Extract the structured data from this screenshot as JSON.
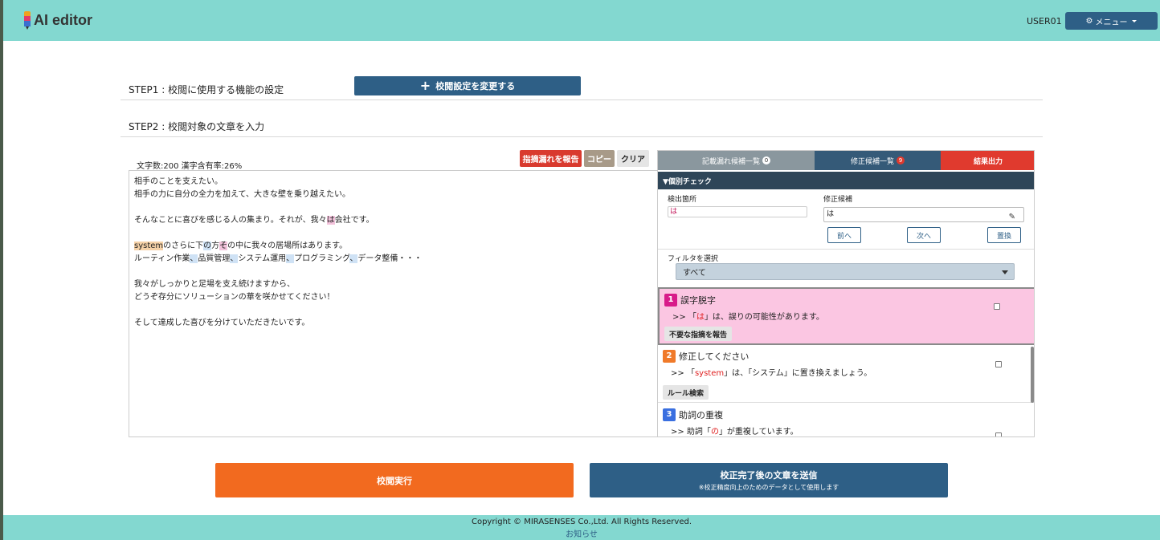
{
  "header": {
    "logo_text": "AI editor",
    "user": "USER01",
    "menu_label": "メニュー"
  },
  "step1": {
    "label": "STEP1 : 校閲に使用する機能の設定",
    "change_button": "校閲設定を変更する"
  },
  "step2": {
    "label": "STEP2 : 校閲対象の文章を入力"
  },
  "editor": {
    "counter": "文字数:200 漢字含有率:26%",
    "report_button": "指摘漏れを報告",
    "copy_button": "コピー",
    "clear_button": "クリア",
    "line1": "相手のことを支えたい。",
    "line2": "相手の力に自分の全力を加えて、大きな壁を乗り越えたい。",
    "line4a": "そんなことに喜びを感じる人の集まり。それが、我々",
    "line4b": "は",
    "line4c": "会社です。",
    "line6a": "system",
    "line6b": "のさらに下",
    "line6c": "の",
    "line6d": "方",
    "line6e": "そ",
    "line6f": "の中に我々の居場所はあります。",
    "line7a": "ルーティン作業",
    "line7b": "、",
    "line7c": "品質管理",
    "line7d": "、",
    "line7e": "システム運用",
    "line7f": "、",
    "line7g": "プログラミング",
    "line7h": "、",
    "line7i": "データ整備・・・",
    "line9": "我々がしっかりと足場を支え続けますから、",
    "line10": "どうぞ存分にソリューションの華を咲かせてください！",
    "line12": "そして達成した喜びを分けていただきたいです。"
  },
  "panel": {
    "tabs": [
      {
        "label": "記載漏れ候補一覧",
        "badge": "0"
      },
      {
        "label": "修正候補一覧",
        "badge": "9"
      },
      {
        "label": "結果出力"
      }
    ],
    "individual_check": "▼個別チェック",
    "detect_label": "検出箇所",
    "detect_value": "は",
    "fix_label": "修正候補",
    "fix_value": "は",
    "prev": "前へ",
    "next": "次へ",
    "replace": "置換",
    "filter_label": "フィルタを選択",
    "filter_value": "すべて",
    "items": [
      {
        "num": "1",
        "title": "誤字脱字",
        "desc_prefix": ">> 「",
        "desc_key": "は",
        "desc_suffix": "」は、誤りの可能性があります。",
        "button": "不要な指摘を報告"
      },
      {
        "num": "2",
        "title": "修正してください",
        "desc_prefix": ">> 「",
        "desc_key": "system",
        "desc_suffix": "」は、「システム」に置き換えましょう。",
        "button": "ルール検索"
      },
      {
        "num": "3",
        "title": "助詞の重複",
        "desc_prefix": ">> 助詞「",
        "desc_key": "の",
        "desc_suffix": "」が重複しています。"
      }
    ]
  },
  "actions": {
    "execute": "校閲実行",
    "send_main": "校正完了後の文章を送信",
    "send_sub": "※校正精度向上のためのデータとして使用します"
  },
  "footer": {
    "copyright": "Copyright © MIRASENSES Co.,Ltd. All Rights Reserved.",
    "notice": "お知らせ"
  },
  "colors": {
    "header": "#83d8d0",
    "primary": "#2e5f86",
    "accent_orange": "#f26a1f",
    "alert_red": "#e03a2e"
  }
}
